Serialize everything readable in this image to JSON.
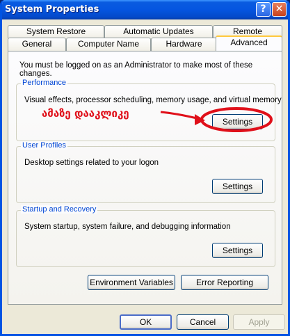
{
  "window": {
    "title": "System Properties",
    "help_glyph": "?",
    "close_glyph": "✕"
  },
  "tabs": {
    "back_row": [
      "System Restore",
      "Automatic Updates",
      "Remote"
    ],
    "front_row": [
      "General",
      "Computer Name",
      "Hardware",
      "Advanced"
    ],
    "active": "Advanced"
  },
  "advanced": {
    "notice": "You must be logged on as an Administrator to make most of these changes.",
    "performance": {
      "label": "Performance",
      "description": "Visual effects, processor scheduling, memory usage, and virtual memory",
      "button": "Settings"
    },
    "user_profiles": {
      "label": "User Profiles",
      "description": "Desktop settings related to your logon",
      "button": "Settings"
    },
    "startup_recovery": {
      "label": "Startup and Recovery",
      "description": "System startup, system failure, and debugging information",
      "button": "Settings"
    },
    "environment_button": "Environment Variables",
    "error_button": "Error Reporting"
  },
  "footer": {
    "ok": "OK",
    "cancel": "Cancel",
    "apply": "Apply"
  },
  "annotation": {
    "text": "ამაზე დააკლიკე",
    "color": "#e0101a"
  }
}
